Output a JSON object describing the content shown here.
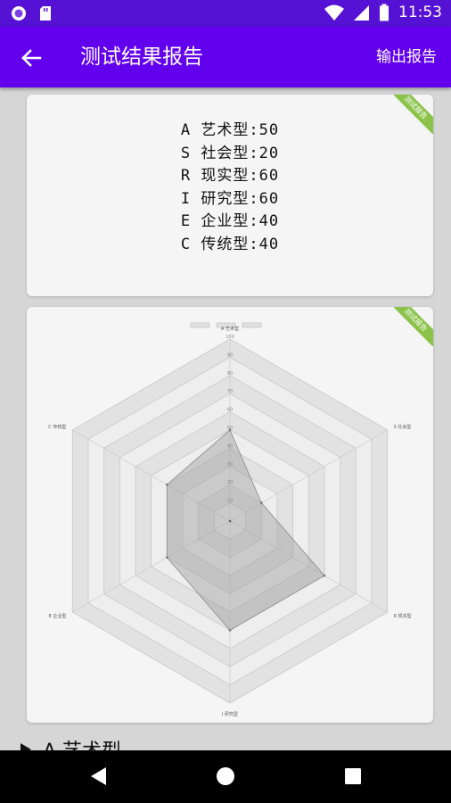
{
  "status_bar": {
    "time": "11:53"
  },
  "app_bar": {
    "title": "测试结果报告",
    "action_label": "输出报告"
  },
  "card_badge": "测试报告",
  "scores": [
    {
      "code": "A",
      "name": "艺术型",
      "value": 50,
      "text": "A 艺术型:50"
    },
    {
      "code": "S",
      "name": "社会型",
      "value": 20,
      "text": "S 社会型:20"
    },
    {
      "code": "R",
      "name": "现实型",
      "value": 60,
      "text": "R 现实型:60"
    },
    {
      "code": "I",
      "name": "研究型",
      "value": 60,
      "text": "I 研究型:60"
    },
    {
      "code": "E",
      "name": "企业型",
      "value": 40,
      "text": "E 企业型:40"
    },
    {
      "code": "C",
      "name": "传统型",
      "value": 40,
      "text": "C 传统型:40"
    }
  ],
  "chart_data": {
    "type": "radar",
    "axes": [
      "A 艺术型",
      "S 社会型",
      "R 现实型",
      "I 研究型",
      "E 企业型",
      "C 传统型"
    ],
    "values": [
      50,
      20,
      60,
      60,
      40,
      40
    ],
    "range": [
      0,
      100
    ],
    "ticks": [
      10,
      20,
      30,
      40,
      50,
      60,
      70,
      80,
      90,
      100
    ],
    "legend": "top-center",
    "grid": true,
    "fill_color": "#9e9e9e",
    "grid_color": "#c8c8c8"
  },
  "section": {
    "heading": "A 艺术型"
  },
  "colors": {
    "status_bar": "#5512d4",
    "app_bar": "#6200ee",
    "badge": "#8bc34a",
    "background": "#d6d6d6"
  }
}
